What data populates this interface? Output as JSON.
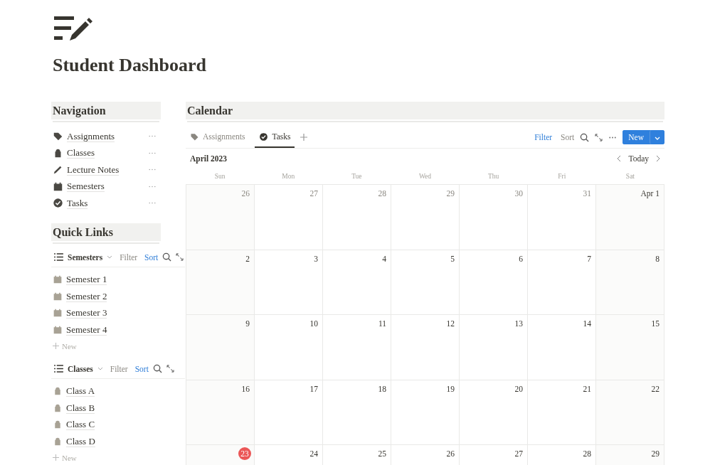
{
  "page": {
    "title": "Student Dashboard"
  },
  "navigation": {
    "heading": "Navigation",
    "items": [
      {
        "label": "Assignments",
        "kind": "tag"
      },
      {
        "label": "Classes",
        "kind": "bag"
      },
      {
        "label": "Lecture Notes",
        "kind": "pen"
      },
      {
        "label": "Semesters",
        "kind": "calendar"
      },
      {
        "label": "Tasks",
        "kind": "check"
      }
    ]
  },
  "quick_links": {
    "heading": "Quick Links",
    "lists": [
      {
        "view": "Semesters",
        "filter": "Filter",
        "filter_active": false,
        "sort": "Sort",
        "sort_active": true,
        "kind": "calendar",
        "items": [
          "Semester 1",
          "Semester 2",
          "Semester 3",
          "Semester 4"
        ],
        "new": "New"
      },
      {
        "view": "Classes",
        "filter": "Filter",
        "filter_active": false,
        "sort": "Sort",
        "sort_active": true,
        "kind": "bag",
        "items": [
          "Class A",
          "Class B",
          "Class C",
          "Class D"
        ],
        "new": "New"
      }
    ]
  },
  "calendar": {
    "heading": "Calendar",
    "tabs": [
      {
        "label": "Assignments",
        "kind": "tag",
        "selected": false
      },
      {
        "label": "Tasks",
        "kind": "check",
        "selected": true
      }
    ],
    "filter": "Filter",
    "filter_active": true,
    "sort": "Sort",
    "sort_active": false,
    "new_button": "New",
    "month": "April 2023",
    "today_button": "Today",
    "weekdays": [
      "Sun",
      "Mon",
      "Tue",
      "Wed",
      "Thu",
      "Fri",
      "Sat"
    ],
    "weeks": [
      [
        {
          "label": "26",
          "muted": true,
          "today": false
        },
        {
          "label": "27",
          "muted": true,
          "today": false
        },
        {
          "label": "28",
          "muted": true,
          "today": false
        },
        {
          "label": "29",
          "muted": true,
          "today": false
        },
        {
          "label": "30",
          "muted": true,
          "today": false
        },
        {
          "label": "31",
          "muted": true,
          "today": false
        },
        {
          "label": "Apr 1",
          "muted": false,
          "today": false
        }
      ],
      [
        {
          "label": "2",
          "muted": false,
          "today": false
        },
        {
          "label": "3",
          "muted": false,
          "today": false
        },
        {
          "label": "4",
          "muted": false,
          "today": false
        },
        {
          "label": "5",
          "muted": false,
          "today": false
        },
        {
          "label": "6",
          "muted": false,
          "today": false
        },
        {
          "label": "7",
          "muted": false,
          "today": false
        },
        {
          "label": "8",
          "muted": false,
          "today": false
        }
      ],
      [
        {
          "label": "9",
          "muted": false,
          "today": false
        },
        {
          "label": "10",
          "muted": false,
          "today": false
        },
        {
          "label": "11",
          "muted": false,
          "today": false
        },
        {
          "label": "12",
          "muted": false,
          "today": false
        },
        {
          "label": "13",
          "muted": false,
          "today": false
        },
        {
          "label": "14",
          "muted": false,
          "today": false
        },
        {
          "label": "15",
          "muted": false,
          "today": false
        }
      ],
      [
        {
          "label": "16",
          "muted": false,
          "today": false
        },
        {
          "label": "17",
          "muted": false,
          "today": false
        },
        {
          "label": "18",
          "muted": false,
          "today": false
        },
        {
          "label": "19",
          "muted": false,
          "today": false
        },
        {
          "label": "20",
          "muted": false,
          "today": false
        },
        {
          "label": "21",
          "muted": false,
          "today": false
        },
        {
          "label": "22",
          "muted": false,
          "today": false
        }
      ],
      [
        {
          "label": "23",
          "muted": false,
          "today": true
        },
        {
          "label": "24",
          "muted": false,
          "today": false
        },
        {
          "label": "25",
          "muted": false,
          "today": false
        },
        {
          "label": "26",
          "muted": false,
          "today": false
        },
        {
          "label": "27",
          "muted": false,
          "today": false
        },
        {
          "label": "28",
          "muted": false,
          "today": false
        },
        {
          "label": "29",
          "muted": false,
          "today": false
        }
      ]
    ]
  }
}
